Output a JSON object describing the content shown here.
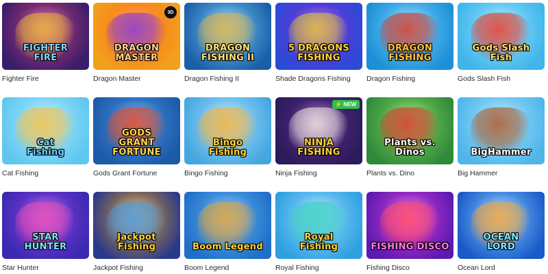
{
  "games": [
    {
      "name": "Fighter Fire",
      "logo": "FIGHTER\nFIRE",
      "bg": "#3a1d6b",
      "bg2": "#c23a7a",
      "art": "#e9b23a",
      "logo_color": "#7fd3ff"
    },
    {
      "name": "Dragon Master",
      "logo": "DRAGON\nMASTER",
      "bg": "#f2a11d",
      "bg2": "#ff6a1a",
      "art": "#8a3bd1",
      "logo_color": "#ffd28a",
      "corner": "3D"
    },
    {
      "name": "Dragon Fishing II",
      "logo": "DRAGON\nFISHING II",
      "bg": "#1a5fa8",
      "bg2": "#6ec3f0",
      "art": "#d9b24a",
      "logo_color": "#ffe27a"
    },
    {
      "name": "Shade Dragons Fishing",
      "logo": "5 DRAGONS\nFISHING",
      "bg": "#2b4bd6",
      "bg2": "#7b2bd6",
      "art": "#e2c23a",
      "logo_color": "#ffd43a"
    },
    {
      "name": "Dragon Fishing",
      "logo": "DRAGON\nFISHING",
      "bg": "#1c8fd6",
      "bg2": "#72d0ff",
      "art": "#d23a2a",
      "logo_color": "#ffc23a"
    },
    {
      "name": "Gods Slash Fish",
      "logo": "Gods Slash Fish",
      "bg": "#3fb5ea",
      "bg2": "#8fe1ff",
      "art": "#e63a2a",
      "logo_color": "#ffe26a"
    },
    {
      "name": "Cat Fishing",
      "logo": "Cat\nFishing",
      "bg": "#5fc7ef",
      "bg2": "#a6e7ff",
      "art": "#f2c14a",
      "logo_color": "#6fd0ff"
    },
    {
      "name": "Gods Grant Fortune",
      "logo": "GODS\nGRANT FORTUNE",
      "bg": "#1d5aa8",
      "bg2": "#3f8fe0",
      "art": "#e64a2a",
      "logo_color": "#ffd84a"
    },
    {
      "name": "Bingo Fishing",
      "logo": "Bingo\nFishing",
      "bg": "#45a7e0",
      "bg2": "#9fdcff",
      "art": "#f2b23a",
      "logo_color": "#ffd23a"
    },
    {
      "name": "Ninja Fishing",
      "logo": "NINJA\nFISHING",
      "bg": "#2b1b5a",
      "bg2": "#5a2b8a",
      "art": "#f0e2e0",
      "logo_color": "#ffd23a",
      "badge": "NEW"
    },
    {
      "name": "Plants vs. Dino",
      "logo": "Plants vs. Dinos",
      "bg": "#2f8a3a",
      "bg2": "#7fd15a",
      "art": "#d83a2a",
      "logo_color": "#ffffff"
    },
    {
      "name": "Big Hammer",
      "logo": "BigHammer",
      "bg": "#4fb6ea",
      "bg2": "#9fe0ff",
      "art": "#a85a2a",
      "logo_color": "#ffffff"
    },
    {
      "name": "Star Hunter",
      "logo": "STAR\nHUNTER",
      "bg": "#3a2ab0",
      "bg2": "#8a3ae0",
      "art": "#e84ab8",
      "logo_color": "#7fe0ff"
    },
    {
      "name": "Jackpot Fishing",
      "logo": "Jackpot Fishing",
      "bg": "#2a3a8a",
      "bg2": "#d89a2a",
      "art": "#4a9ae8",
      "logo_color": "#ffd23a"
    },
    {
      "name": "Boom Legend",
      "logo": "Boom Legend",
      "bg": "#1f6fc8",
      "bg2": "#5fb0f0",
      "art": "#e0a23a",
      "logo_color": "#ffd23a"
    },
    {
      "name": "Royal Fishing",
      "logo": "Royal\nFishing",
      "bg": "#2ea0e0",
      "bg2": "#8fd8ff",
      "art": "#3ad0c0",
      "logo_color": "#ffd23a"
    },
    {
      "name": "Fishing Disco",
      "logo": "FISHING DISCO",
      "bg": "#5a1ab0",
      "bg2": "#d83ad8",
      "art": "#ff4a6a",
      "logo_color": "#ff7ae0"
    },
    {
      "name": "Ocean Lord",
      "logo": "OCEAN\nLORD",
      "bg": "#1a5ac8",
      "bg2": "#7fc8ff",
      "art": "#f2a23a",
      "logo_color": "#7fe8ff"
    }
  ]
}
